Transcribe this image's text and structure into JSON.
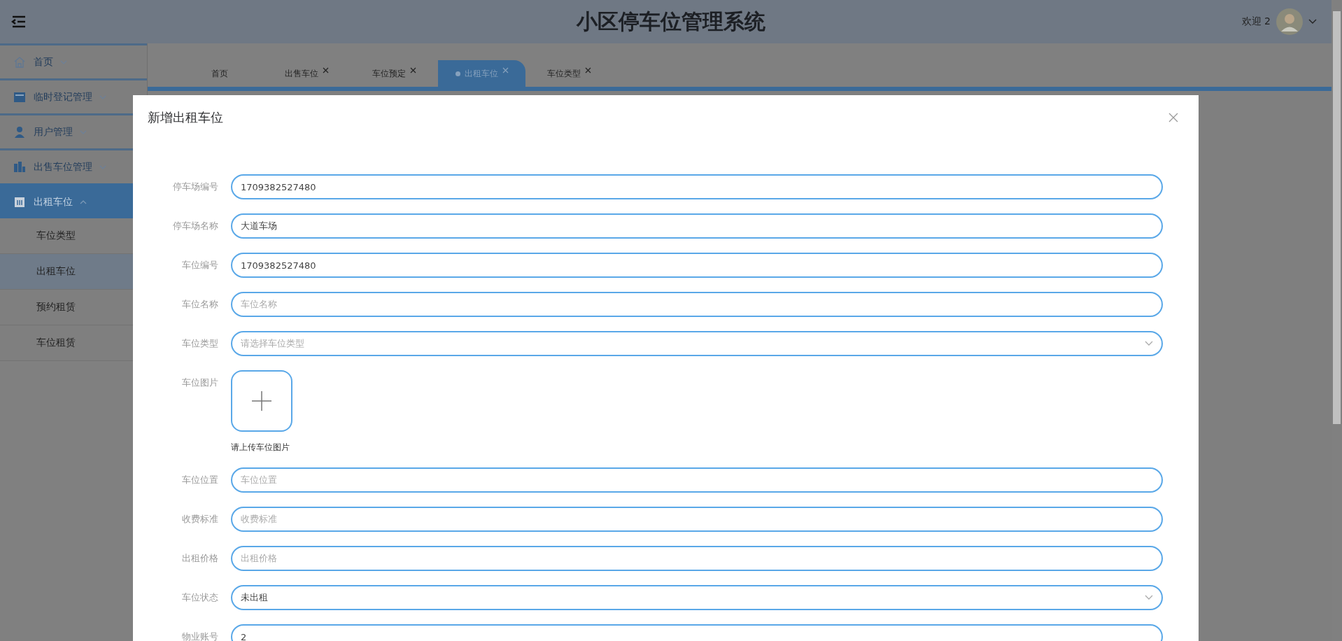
{
  "header": {
    "title": "小区停车位管理系统",
    "welcome": "欢迎 2"
  },
  "sidebar": {
    "items": [
      {
        "label": "首页",
        "expanded": false,
        "selected": false
      },
      {
        "label": "临时登记管理",
        "expanded": false,
        "selected": false
      },
      {
        "label": "用户管理",
        "expanded": false,
        "selected": false
      },
      {
        "label": "出售车位管理",
        "expanded": false,
        "selected": false
      },
      {
        "label": "出租车位",
        "expanded": true,
        "selected": true,
        "children": [
          {
            "label": "车位类型",
            "selected": false
          },
          {
            "label": "出租车位",
            "selected": true
          },
          {
            "label": "预约租赁",
            "selected": false
          },
          {
            "label": "车位租赁",
            "selected": false
          }
        ]
      }
    ]
  },
  "tabs": [
    {
      "label": "首页",
      "closable": false,
      "selected": false
    },
    {
      "label": "出售车位",
      "closable": true,
      "selected": false
    },
    {
      "label": "车位预定",
      "closable": true,
      "selected": false
    },
    {
      "label": "出租车位",
      "closable": true,
      "selected": true
    },
    {
      "label": "车位类型",
      "closable": true,
      "selected": false
    }
  ],
  "dialog": {
    "title": "新增出租车位",
    "fields": [
      {
        "kind": "input",
        "label": "停车场编号",
        "value": "1709382527480"
      },
      {
        "kind": "input",
        "label": "停车场名称",
        "value": "大道车场"
      },
      {
        "kind": "input",
        "label": "车位编号",
        "value": "1709382527480"
      },
      {
        "kind": "input",
        "label": "车位名称",
        "placeholder": "车位名称"
      },
      {
        "kind": "select",
        "label": "车位类型",
        "placeholder": "请选择车位类型"
      },
      {
        "kind": "upload",
        "label": "车位图片",
        "hint": "请上传车位图片"
      },
      {
        "kind": "input",
        "label": "车位位置",
        "placeholder": "车位位置"
      },
      {
        "kind": "input",
        "label": "收费标准",
        "placeholder": "收费标准"
      },
      {
        "kind": "input",
        "label": "出租价格",
        "placeholder": "出租价格"
      },
      {
        "kind": "select",
        "label": "车位状态",
        "value": "未出租"
      },
      {
        "kind": "input",
        "label": "物业账号",
        "value": "2"
      }
    ]
  }
}
